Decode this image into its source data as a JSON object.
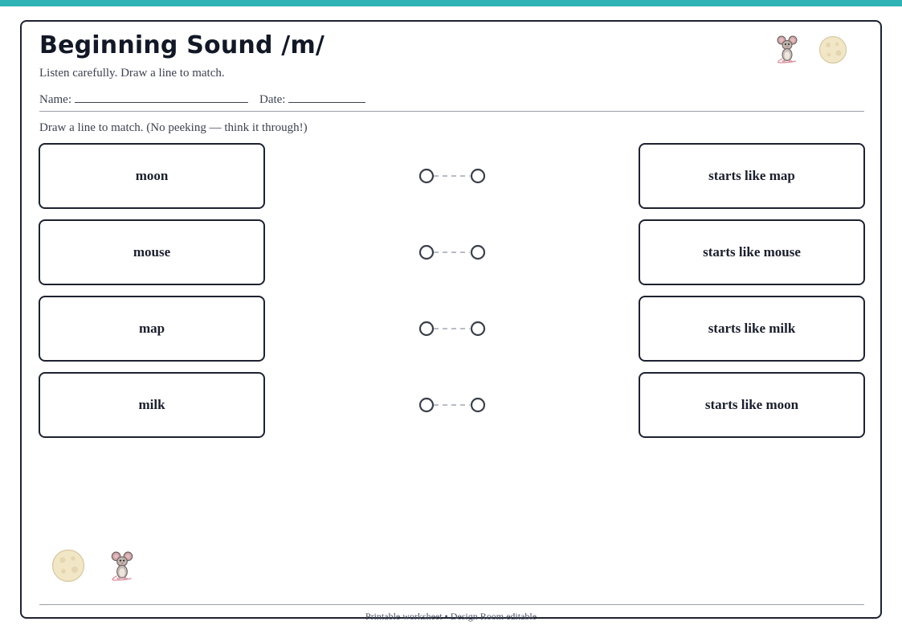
{
  "worksheet": {
    "title": "Beginning Sound /m/",
    "subtitle": "Listen carefully. Draw a line to match.",
    "name_label": "Name:",
    "date_label": "Date:",
    "instructions": "Draw a line to match. (No peeking — think it through!)",
    "left_items": [
      {
        "label": "moon"
      },
      {
        "label": "mouse"
      },
      {
        "label": "map"
      },
      {
        "label": "milk"
      }
    ],
    "right_items": [
      {
        "label": "starts like map"
      },
      {
        "label": "starts like mouse"
      },
      {
        "label": "starts like milk"
      },
      {
        "label": "starts like moon"
      }
    ],
    "footer": "Printable worksheet • Design Room editable"
  },
  "icons": {
    "header": [
      "mouse-icon",
      "moon-icon"
    ],
    "footer": [
      "moon-icon",
      "mouse-icon"
    ]
  },
  "colors": {
    "accent_bar": "#2fb3b6",
    "border": "#1e2230",
    "text": "#1f2433",
    "connector_dash": "#b8bcc4",
    "moon_fill": "#f1e6c6"
  }
}
